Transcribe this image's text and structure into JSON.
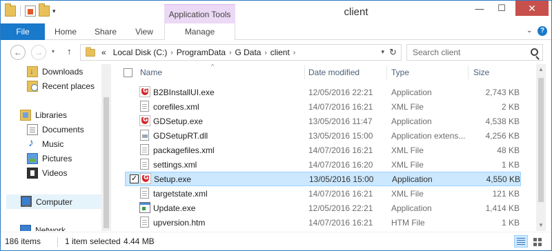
{
  "window": {
    "title": "client",
    "contextual_tab_group": "Application Tools",
    "controls": {
      "minimize": "—",
      "maximize": "☐",
      "close": "✕"
    }
  },
  "ribbon": {
    "tabs": [
      {
        "label": "File"
      },
      {
        "label": "Home"
      },
      {
        "label": "Share"
      },
      {
        "label": "View"
      },
      {
        "label": "Manage"
      }
    ],
    "help": "?"
  },
  "address": {
    "overflow": "«",
    "crumbs": [
      "Local Disk (C:)",
      "ProgramData",
      "G Data",
      "client"
    ],
    "search_placeholder": "Search client"
  },
  "nav_pane": {
    "items": [
      {
        "label": "Downloads",
        "icon": "downloads-icon"
      },
      {
        "label": "Recent places",
        "icon": "recent-places-icon"
      },
      {
        "label": "Libraries",
        "icon": "libraries-icon"
      },
      {
        "label": "Documents",
        "icon": "documents-icon"
      },
      {
        "label": "Music",
        "icon": "music-icon"
      },
      {
        "label": "Pictures",
        "icon": "pictures-icon"
      },
      {
        "label": "Videos",
        "icon": "videos-icon"
      },
      {
        "label": "Computer",
        "icon": "computer-icon"
      },
      {
        "label": "Network",
        "icon": "network-icon"
      }
    ]
  },
  "file_list": {
    "columns": {
      "name": "Name",
      "date": "Date modified",
      "type": "Type",
      "size": "Size"
    },
    "rows": [
      {
        "name": "B2BInstallUI.exe",
        "date": "12/05/2016 22:21",
        "type": "Application",
        "size": "2,743 KB",
        "icon": "gdata-app-icon",
        "selected": false
      },
      {
        "name": "corefiles.xml",
        "date": "14/07/2016 16:21",
        "type": "XML File",
        "size": "2 KB",
        "icon": "xml-file-icon",
        "selected": false
      },
      {
        "name": "GDSetup.exe",
        "date": "13/05/2016 11:47",
        "type": "Application",
        "size": "4,538 KB",
        "icon": "gdata-app-icon",
        "selected": false
      },
      {
        "name": "GDSetupRT.dll",
        "date": "13/05/2016 15:00",
        "type": "Application extens...",
        "size": "4,256 KB",
        "icon": "dll-file-icon",
        "selected": false
      },
      {
        "name": "packagefiles.xml",
        "date": "14/07/2016 16:21",
        "type": "XML File",
        "size": "48 KB",
        "icon": "xml-file-icon",
        "selected": false
      },
      {
        "name": "settings.xml",
        "date": "14/07/2016 16:20",
        "type": "XML File",
        "size": "1 KB",
        "icon": "xml-file-icon",
        "selected": false
      },
      {
        "name": "Setup.exe",
        "date": "13/05/2016 15:00",
        "type": "Application",
        "size": "4,550 KB",
        "icon": "gdata-app-icon",
        "selected": true
      },
      {
        "name": "targetstate.xml",
        "date": "14/07/2016 16:21",
        "type": "XML File",
        "size": "121 KB",
        "icon": "xml-file-icon",
        "selected": false
      },
      {
        "name": "Update.exe",
        "date": "12/05/2016 22:21",
        "type": "Application",
        "size": "1,414 KB",
        "icon": "app-icon",
        "selected": false
      },
      {
        "name": "upversion.htm",
        "date": "14/07/2016 16:21",
        "type": "HTM File",
        "size": "1 KB",
        "icon": "htm-file-icon",
        "selected": false
      }
    ]
  },
  "status_bar": {
    "item_count": "186 items",
    "selection": "1 item selected",
    "selection_size": "4.44 MB"
  }
}
